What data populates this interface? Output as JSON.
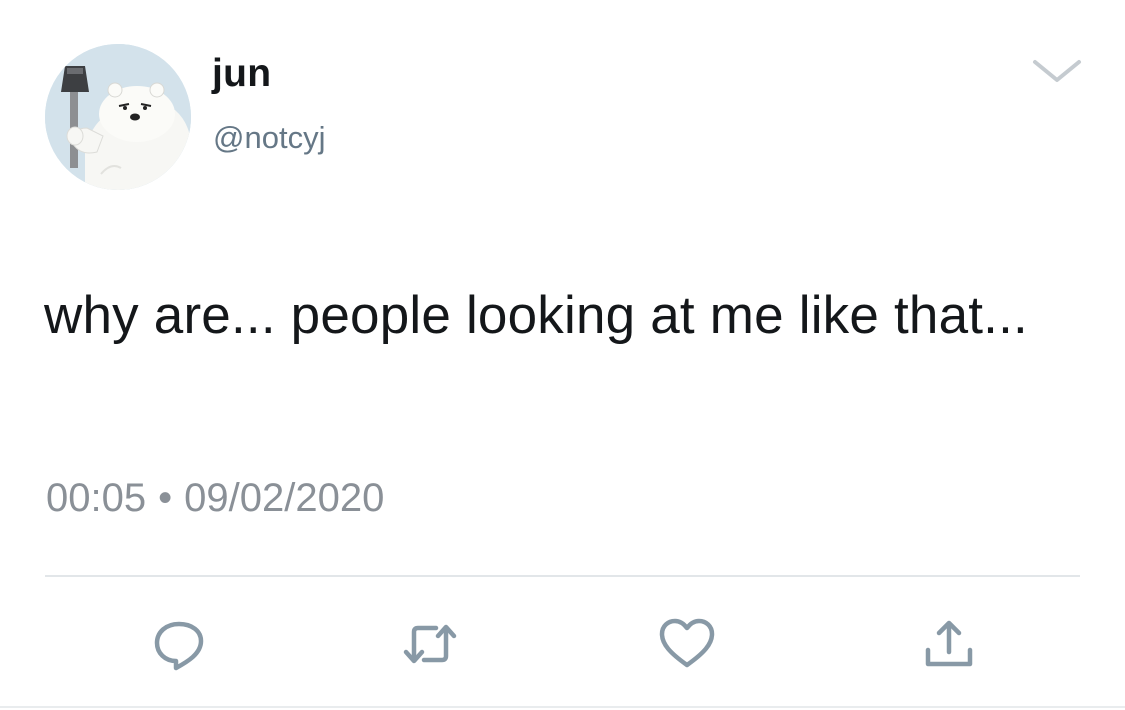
{
  "user": {
    "display_name": "jun",
    "handle": "@notcyj",
    "avatar_icon": "polar-bear-with-axe-avatar"
  },
  "tweet": {
    "text": "why are... people looking at me like that..."
  },
  "meta": {
    "time": "00:05",
    "separator": "•",
    "date": "09/02/2020"
  },
  "actions": {
    "reply_icon": "reply-icon",
    "retweet_icon": "retweet-icon",
    "like_icon": "heart-icon",
    "share_icon": "share-icon"
  },
  "colors": {
    "text": "#14171a",
    "secondary": "#657786",
    "icon": "#8899a6",
    "divider": "#e2e6e9"
  }
}
